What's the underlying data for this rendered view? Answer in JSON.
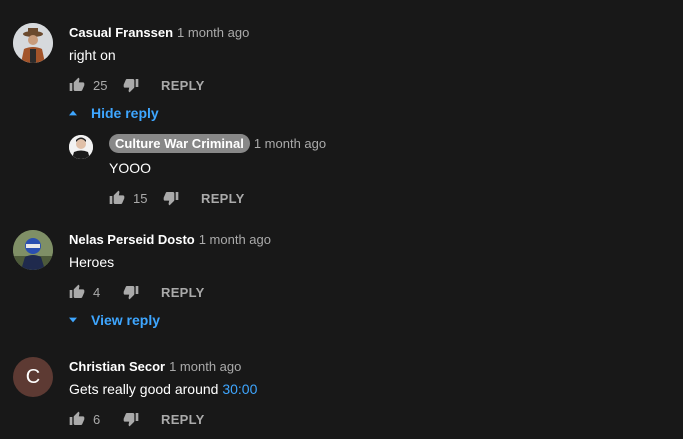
{
  "comments": [
    {
      "author": "Casual Franssen",
      "time": "1 month ago",
      "text": "right on",
      "likes": "25",
      "reply_label": "REPLY",
      "replies_toggle": "Hide reply",
      "avatar_icon": "user-photo-icon"
    },
    {
      "author": "Culture War Criminal",
      "time": "1 month ago",
      "text": "YOOO",
      "likes": "15",
      "reply_label": "REPLY",
      "avatar_icon": "user-photo-icon"
    },
    {
      "author": "Nelas Perseid Dosto",
      "time": "1 month ago",
      "text": "Heroes",
      "likes": "4",
      "reply_label": "REPLY",
      "replies_toggle": "View reply",
      "avatar_icon": "user-photo-icon"
    },
    {
      "author": "Christian Secor",
      "time": "1 month ago",
      "text": "Gets really good around",
      "timestamp_link": "30:00",
      "likes": "6",
      "reply_label": "REPLY",
      "avatar_letter": "C"
    }
  ],
  "colors": {
    "background": "#181818",
    "link": "#3ea6ff",
    "meta": "#aaaaaa",
    "highlight_badge": "#888888",
    "letter_avatar": "#5d3a33"
  }
}
